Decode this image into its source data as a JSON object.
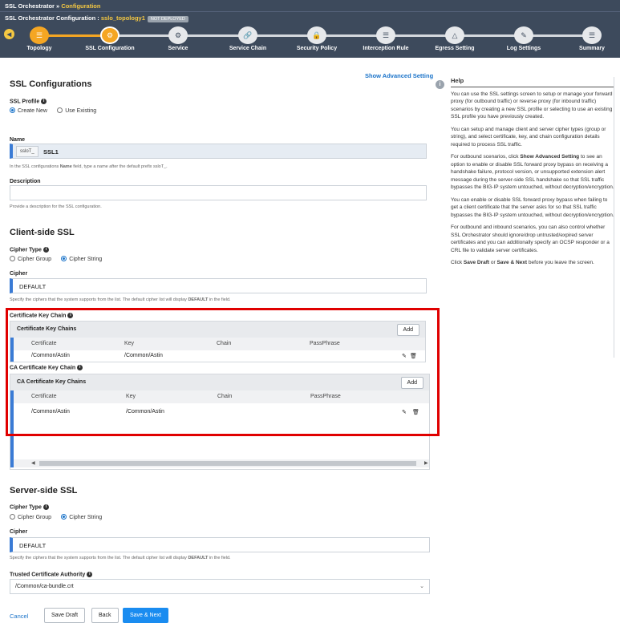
{
  "breadcrumb": {
    "app": "SSL Orchestrator",
    "sep": " » ",
    "page": "Configuration"
  },
  "config": {
    "prefix": "SSL Orchestrator Configuration : ",
    "name": "sslo_topology1",
    "status": "NOT DEPLOYED"
  },
  "wizard": {
    "steps": [
      "Topology",
      "SSL Configuration",
      "Service",
      "Service Chain",
      "Security Policy",
      "Interception Rule",
      "Egress Setting",
      "Log Settings",
      "Summary"
    ]
  },
  "main": {
    "title": "SSL Configurations",
    "show_advanced": "Show Advanced Setting",
    "ssl_profile": {
      "label": "SSL Profile",
      "create_new": "Create New",
      "use_existing": "Use Existing"
    },
    "name": {
      "label": "Name",
      "prefix": "ssloT_",
      "value": "SSL1",
      "hint_pre": "In the SSL configurations ",
      "hint_bold": "Name",
      "hint_post": " field, type a name after the default prefix ssloT_."
    },
    "description": {
      "label": "Description",
      "hint": "Provide a description for the SSL configuration."
    },
    "client": {
      "title": "Client-side SSL",
      "cipher_type_label": "Cipher Type",
      "cipher_group": "Cipher Group",
      "cipher_string": "Cipher String",
      "cipher_label": "Cipher",
      "cipher_value": "DEFAULT",
      "cipher_hint_pre": "Specify the ciphers that the system supports from the list. The default cipher list will display ",
      "cipher_hint_bold": "DEFAULT",
      "cipher_hint_post": " in the field.",
      "cert_key_chain_label": "Certificate Key Chain",
      "cert_key_chains_title": "Certificate Key Chains",
      "ca_key_chain_label": "CA Certificate Key Chain",
      "ca_key_chains_title": "CA Certificate Key Chains",
      "add": "Add",
      "columns": [
        "Certificate",
        "Key",
        "Chain",
        "PassPhrase"
      ],
      "cert_row": {
        "certificate": "/Common/Astin",
        "key": "/Common/Astin"
      },
      "ca_row": {
        "certificate": "/Common/Astin",
        "key": "/Common/Astin"
      }
    },
    "server": {
      "title": "Server-side SSL",
      "cipher_type_label": "Cipher Type",
      "cipher_group": "Cipher Group",
      "cipher_string": "Cipher String",
      "cipher_label": "Cipher",
      "cipher_value": "DEFAULT",
      "cipher_hint_pre": "Specify the ciphers that the system supports from the list. The default cipher list will display ",
      "cipher_hint_bold": "DEFAULT",
      "cipher_hint_post": " in the field.",
      "trusted_ca_label": "Trusted Certificate Authority",
      "trusted_ca_value": "/Common/ca-bundle.crt"
    },
    "footer": {
      "cancel": "Cancel",
      "save_draft": "Save Draft",
      "back": "Back",
      "save_next": "Save & Next"
    }
  },
  "help": {
    "title": "Help",
    "p1": "You can use the SSL settings screen to setup or manage your forward proxy (for outbound traffic) or reverse proxy (for inbound traffic) scenarios by creating a new SSL profile or selecting to use an existing SSL profile you have previously created.",
    "p2": "You can setup and manage client and server cipher types (group or string), and select certificate, key, and chain configuration details required to process SSL traffic.",
    "p3_pre": "For outbound scenarios, click ",
    "p3_bold": "Show Advanced Setting",
    "p3_post": " to see an option to enable or disable SSL forward proxy bypass on receiving a handshake failure, protocol version, or unsupported extension alert message during the server-side SSL handshake so that SSL traffic bypasses the BIG-IP system untouched, without decryption/encryption.",
    "p4": "You can enable or disable SSL forward proxy bypass when failing to get a client certificate that the server asks for so that SSL traffic bypasses the BIG-IP system untouched, without decryption/encryption.",
    "p5": "For outbound and inbound scenarios, you can also control whether SSL Orchestrator should ignore/drop untrusted/expired server certificates and you can additionally specify an OCSP responder or a CRL file to validate server certificates.",
    "p6_pre": "Click ",
    "p6_b1": "Save Draft",
    "p6_mid": " or ",
    "p6_b2": "Save & Next",
    "p6_post": " before you leave the screen."
  },
  "colors": {
    "header_bg": "#3d4a5c",
    "accent": "#f5a623",
    "link": "#1a73c9",
    "primary": "#1a8cf0",
    "highlight": "#e00000"
  }
}
